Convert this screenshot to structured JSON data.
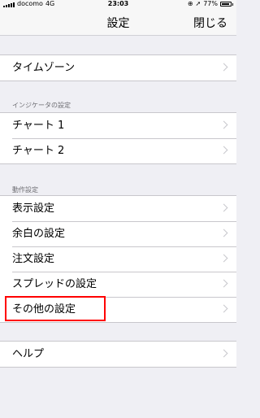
{
  "status_bar": {
    "carrier": "docomo",
    "network": "4G",
    "time": "23:03",
    "battery": "77%"
  },
  "nav": {
    "title": "設定",
    "close_label": "閉じる"
  },
  "sections": {
    "timezone": {
      "items": [
        {
          "label": "タイムゾーン"
        }
      ]
    },
    "indicator": {
      "header": "インジケータの設定",
      "items": [
        {
          "label": "チャート 1"
        },
        {
          "label": "チャート 2"
        }
      ]
    },
    "behavior": {
      "header": "動作設定",
      "items": [
        {
          "label": "表示設定"
        },
        {
          "label": "余白の設定"
        },
        {
          "label": "注文設定"
        },
        {
          "label": "スプレッドの設定"
        },
        {
          "label": "その他の設定"
        }
      ]
    },
    "help": {
      "items": [
        {
          "label": "ヘルプ"
        }
      ]
    }
  },
  "colors": {
    "background": "#efeff4",
    "highlight": "#ff0000",
    "separator": "#c8c7cc"
  }
}
